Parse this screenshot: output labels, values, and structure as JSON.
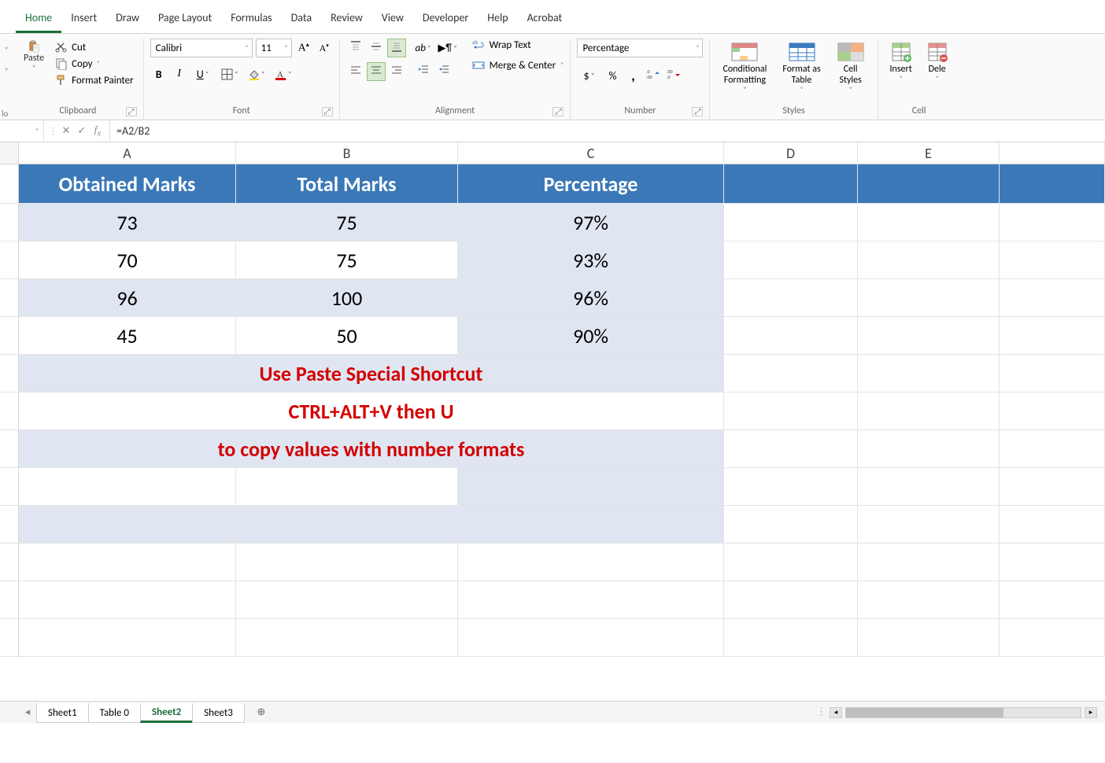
{
  "tabs": {
    "home": "Home",
    "insert": "Insert",
    "draw": "Draw",
    "pageLayout": "Page Layout",
    "formulas": "Formulas",
    "data": "Data",
    "review": "Review",
    "view": "View",
    "developer": "Developer",
    "help": "Help",
    "acrobat": "Acrobat"
  },
  "ribbon": {
    "clipboard": {
      "paste": "Paste",
      "cut": "Cut",
      "copy": "Copy",
      "formatPainter": "Format Painter",
      "groupLabel": "Clipboard"
    },
    "font": {
      "name": "Calibri",
      "size": "11",
      "groupLabel": "Font"
    },
    "alignment": {
      "wrapText": "Wrap Text",
      "mergeCenter": "Merge & Center",
      "groupLabel": "Alignment"
    },
    "number": {
      "format": "Percentage",
      "groupLabel": "Number"
    },
    "styles": {
      "conditional": "Conditional\nFormatting",
      "formatAs": "Format as\nTable",
      "cellStyles": "Cell\nStyles",
      "groupLabel": "Styles"
    },
    "cells": {
      "insert": "Insert",
      "delete": "Dele",
      "groupLabel": "Cell"
    }
  },
  "undoLabel": "lo",
  "formulaBar": {
    "formula": "=A2/B2"
  },
  "columns": [
    "A",
    "B",
    "C",
    "D",
    "E"
  ],
  "table": {
    "headers": {
      "a": "Obtained Marks",
      "b": "Total Marks",
      "c": "Percentage"
    },
    "rows": [
      {
        "obtained": "73",
        "total": "75",
        "pct": "97%"
      },
      {
        "obtained": "70",
        "total": "75",
        "pct": "93%"
      },
      {
        "obtained": "96",
        "total": "100",
        "pct": "96%"
      },
      {
        "obtained": "45",
        "total": "50",
        "pct": "90%"
      }
    ],
    "tip1": "Use Paste Special Shortcut",
    "tip2": "CTRL+ALT+V then U",
    "tip3": "to copy values with number formats"
  },
  "sheetTabs": {
    "sheet1": "Sheet1",
    "table0": "Table 0",
    "sheet2": "Sheet2",
    "sheet3": "Sheet3"
  }
}
